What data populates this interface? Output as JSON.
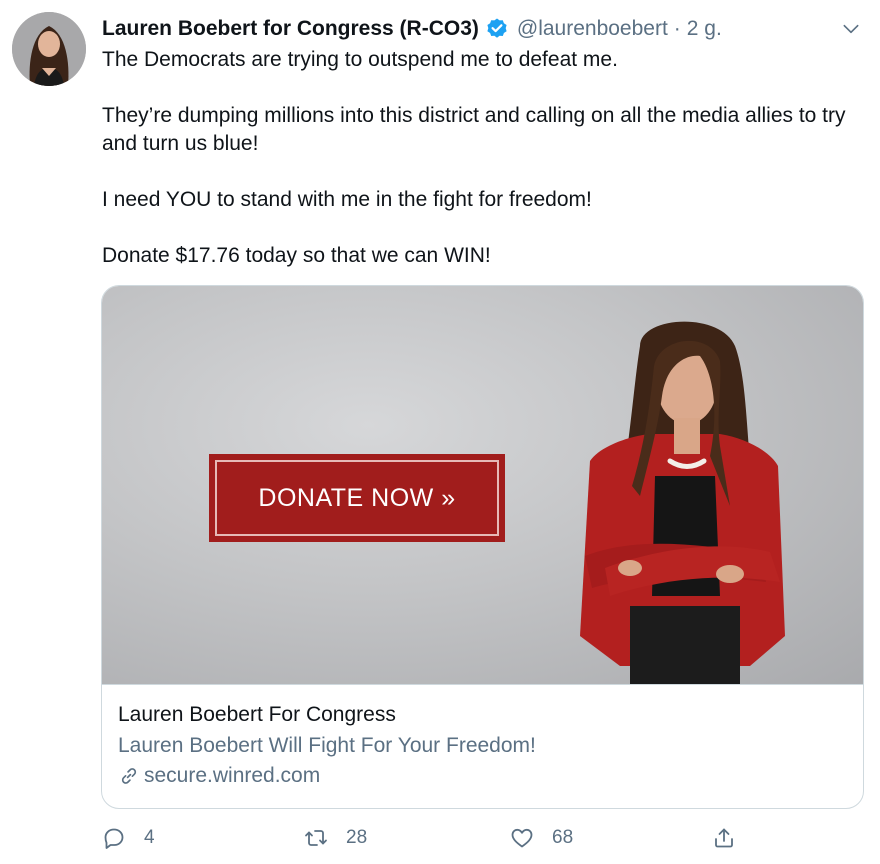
{
  "tweet": {
    "author_name": "Lauren Boebert for Congress (R-CO3)",
    "handle": "@laurenboebert",
    "separator": "·",
    "time": "2 g.",
    "paragraphs": [
      "The Democrats are trying to outspend me to defeat me.",
      "They’re dumping millions into this district and calling on all the media allies to try and turn us blue!",
      "I need YOU to stand with me in the fight for freedom!",
      "Donate $17.76 today so that we can WIN!"
    ]
  },
  "card": {
    "image_button_text": "DONATE NOW »",
    "title": "Lauren Boebert For Congress",
    "description": "Lauren Boebert Will Fight For Your Freedom!",
    "domain": "secure.winred.com"
  },
  "actions": {
    "reply_count": "4",
    "retweet_count": "28",
    "like_count": "68"
  },
  "icons": {
    "verified": "verified-badge-icon",
    "caret": "chevron-down-icon",
    "link": "link-icon",
    "reply": "reply-icon",
    "retweet": "retweet-icon",
    "like": "heart-icon",
    "share": "share-icon"
  },
  "colors": {
    "verified_blue": "#1da1f2",
    "secondary_text": "#5b7083",
    "donate_red": "#a11d1c"
  }
}
